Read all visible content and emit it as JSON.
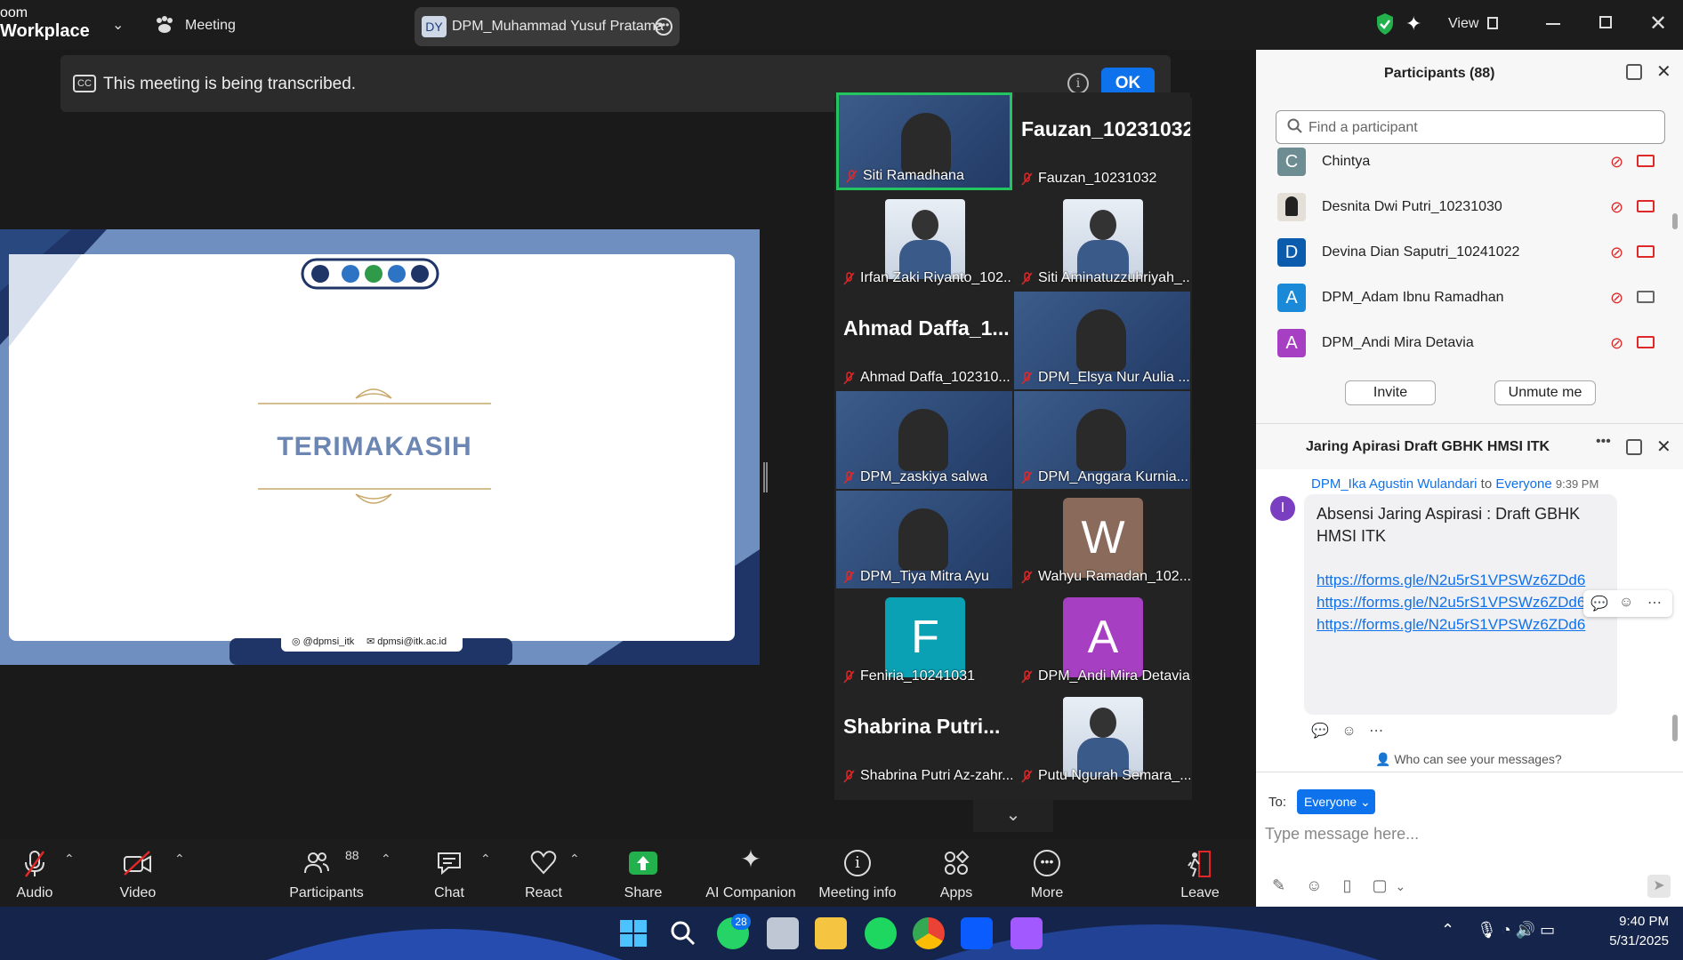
{
  "app": {
    "brand_line1": "oom",
    "brand_line2": "Workplace",
    "meeting_label": "Meeting",
    "speaker_initials": "DY",
    "speaker_name": "DPM_Muhammad Yusuf Pratama",
    "view_label": "View"
  },
  "banner": {
    "cc_label": "CC",
    "text": "This meeting is being transcribed.",
    "ok_label": "OK"
  },
  "slide": {
    "title": "TERIMAKASIH",
    "instagram": "@dpmsi_itk",
    "email": "dpmsi@itk.ac.id"
  },
  "gallery": [
    {
      "name": "Siti Ramadhana",
      "type": "video",
      "active": true
    },
    {
      "name": "Fauzan_10231032",
      "type": "bigname",
      "big": "Fauzan_10231032"
    },
    {
      "name": "Irfan Zaki Riyanto_102...",
      "type": "photo"
    },
    {
      "name": "Siti Aminatuzzuhriyah_...",
      "type": "photo"
    },
    {
      "name": "Ahmad Daffa_102310...",
      "type": "bigname",
      "big": "Ahmad  Daffa_1..."
    },
    {
      "name": "DPM_Elsya Nur Aulia ...",
      "type": "video"
    },
    {
      "name": "DPM_zaskiya salwa",
      "type": "video"
    },
    {
      "name": "DPM_Anggara Kurnia...",
      "type": "video"
    },
    {
      "name": "DPM_Tiya Mitra Ayu",
      "type": "video"
    },
    {
      "name": "Wahyu Ramadan_102...",
      "type": "letter",
      "letter": "W",
      "color": "#8a6a5a"
    },
    {
      "name": "Feniria_10241031",
      "type": "letter",
      "letter": "F",
      "color": "#0aa1b5"
    },
    {
      "name": "DPM_Andi Mira Detavia",
      "type": "letter",
      "letter": "A",
      "color": "#a63fc1"
    },
    {
      "name": "Shabrina Putri Az-zahr...",
      "type": "bigname",
      "big": "Shabrina  Putri..."
    },
    {
      "name": "Putu Ngurah Semara_...",
      "type": "photo"
    }
  ],
  "toolbar": {
    "audio": "Audio",
    "video": "Video",
    "participants": "Participants",
    "participants_count": "88",
    "chat": "Chat",
    "react": "React",
    "share": "Share",
    "ai": "AI Companion",
    "info": "Meeting info",
    "apps": "Apps",
    "more": "More",
    "leave": "Leave"
  },
  "participants_panel": {
    "title": "Participants (88)",
    "search_placeholder": "Find a participant",
    "items": [
      {
        "initial": "C",
        "name": "Chintya",
        "color": "#6e8d93"
      },
      {
        "initial": "",
        "name": "Desnita Dwi Putri_10231030",
        "color": "#e4e0d8"
      },
      {
        "initial": "D",
        "name": "Devina Dian Saputri_10241022",
        "color": "#0b5cad"
      },
      {
        "initial": "A",
        "name": "DPM_Adam Ibnu Ramadhan",
        "color": "#1a8ad8"
      },
      {
        "initial": "A",
        "name": "DPM_Andi Mira Detavia",
        "color": "#a63fc1"
      }
    ],
    "invite": "Invite",
    "unmute": "Unmute me"
  },
  "chat_panel": {
    "title": "Jaring Apirasi Draft GBHK HMSI ITK",
    "sender": "DPM_Ika Agustin Wulandari",
    "to_word": "to",
    "recipient": "Everyone",
    "time": "9:39 PM",
    "sender_initial": "I",
    "message": "Absensi Jaring Aspirasi : Draft GBHK HMSI ITK",
    "links": [
      "https://forms.gle/N2u5rS1VPSWz6ZDd6",
      "https://forms.gle/N2u5rS1VPSWz6ZDd6",
      "https://forms.gle/N2u5rS1VPSWz6ZDd6"
    ],
    "who_can_see": "Who can see your messages?",
    "to_label": "To:",
    "to_value": "Everyone",
    "input_placeholder": "Type message here..."
  },
  "taskbar": {
    "whatsapp_badge": "28",
    "time": "9:40 PM",
    "date": "5/31/2025"
  }
}
